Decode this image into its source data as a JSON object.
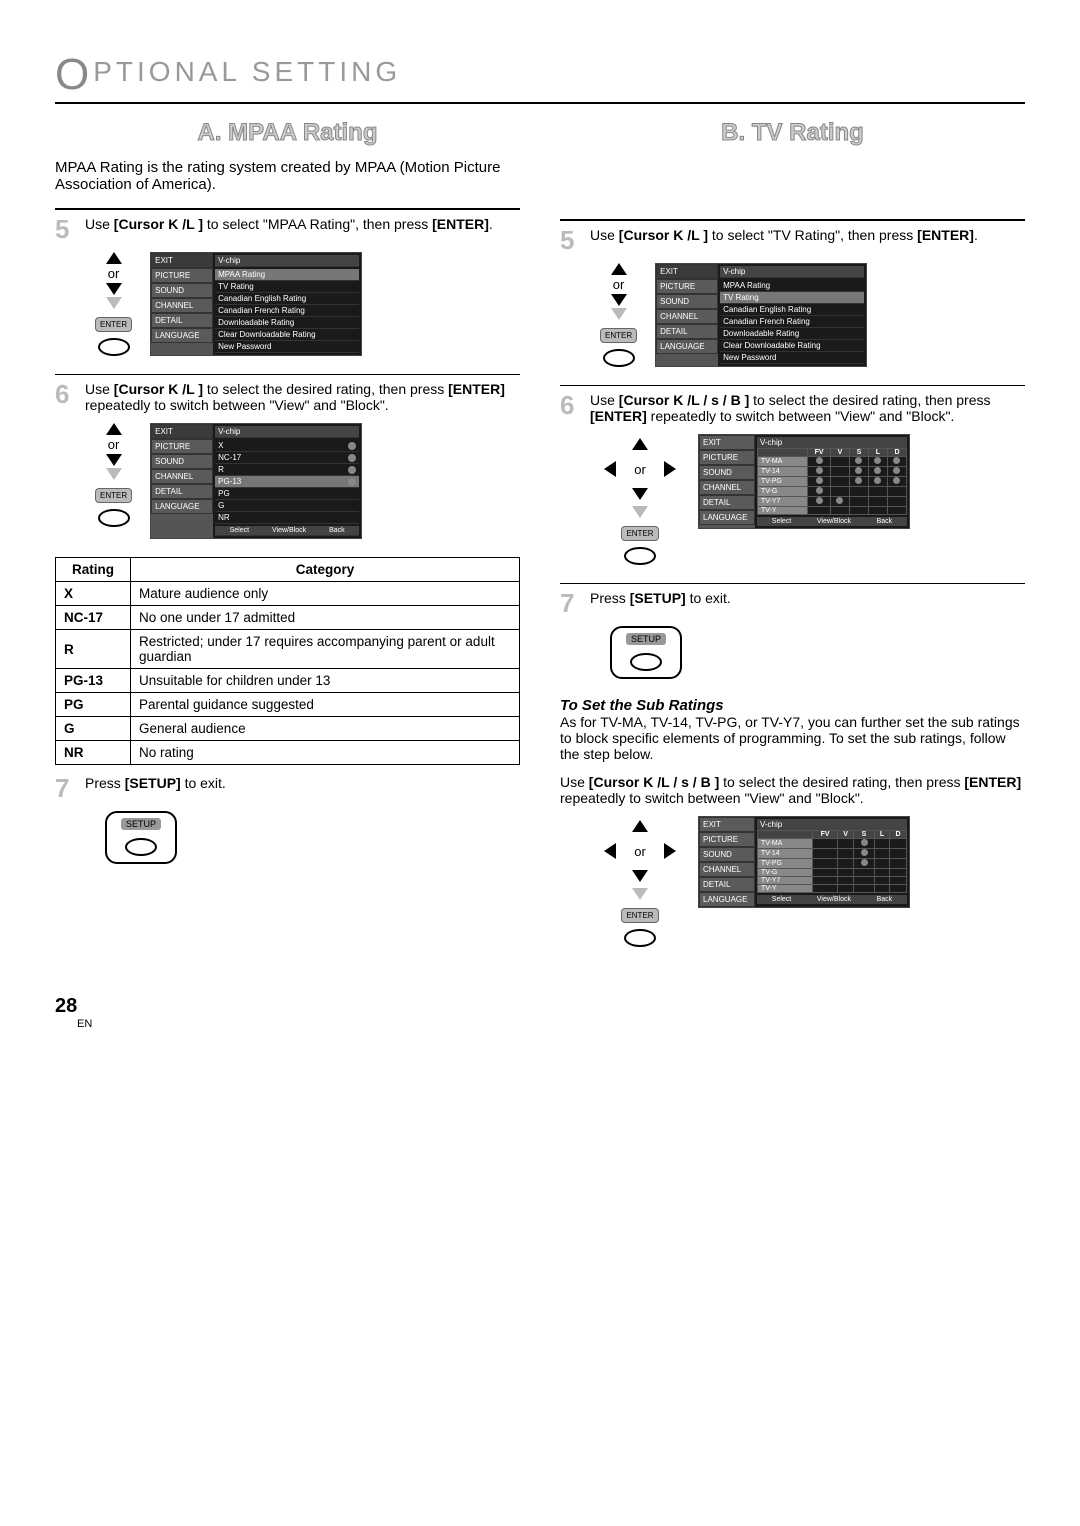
{
  "page": {
    "title_rest": "PTIONAL  SETTING",
    "number": "28",
    "lang": "EN"
  },
  "a": {
    "heading": "A.  MPAA Rating",
    "intro": "MPAA Rating is the rating system created by MPAA (Motion Picture Association of America).",
    "step5": {
      "pre": "Use ",
      "bold1": "[Cursor ",
      "mid": "K /L ]",
      "post": " to select \"MPAA Rating\", then press ",
      "enter": "[ENTER]",
      "tail": "."
    },
    "step6": {
      "text1": "Use ",
      "bold1": "[Cursor ",
      "mid": "K /L ]",
      "text2": " to select the desired rating, then press ",
      "enter": "[ENTER]",
      "text3": " repeatedly to switch between \"View\" and \"Block\"."
    },
    "step7": {
      "pre": "Press ",
      "setup": "[SETUP]",
      "post": " to exit."
    },
    "or": "or",
    "enter_btn": "ENTER",
    "setup_btn": "SETUP"
  },
  "b": {
    "heading": "B.  TV Rating",
    "step5": {
      "pre": "Use ",
      "bold1": "[Cursor ",
      "mid": "K /L ]",
      "post": " to select \"TV Rating\", then press ",
      "enter": "[ENTER]",
      "tail": "."
    },
    "step6": {
      "text1": "Use ",
      "bold1": "[Cursor ",
      "mid": "K /L  / s  / B ]",
      "text2": " to select the desired rating, then press ",
      "enter": "[ENTER]",
      "text3": " repeatedly to switch between \"View\" and \"Block\"."
    },
    "step7": {
      "pre": "Press ",
      "setup": "[SETUP]",
      "post": " to exit."
    },
    "sub_heading": "To Set the Sub Ratings",
    "sub_p1": "As for TV-MA, TV-14, TV-PG, or TV-Y7, you can further set the sub ratings to block specific elements of programming. To set the sub ratings, follow the step below.",
    "sub_p2a": "Use ",
    "sub_bold": "[Cursor ",
    "sub_mid": "K /L  / s  / B ]",
    "sub_p2b": " to select the desired rating, then press ",
    "sub_enter": "[ENTER]",
    "sub_p2c": " repeatedly to switch between \"View\" and \"Block\".",
    "or": "or",
    "enter_btn": "ENTER"
  },
  "osd_tabs": {
    "exit": "EXIT",
    "picture": "PICTURE",
    "sound": "SOUND",
    "channel": "CHANNEL",
    "detail": "DETAIL",
    "language": "LANGUAGE",
    "title": "V-chip",
    "items": [
      "MPAA Rating",
      "TV Rating",
      "Canadian English Rating",
      "Canadian French Rating",
      "Downloadable Rating",
      "Clear Downloadable Rating",
      "New Password"
    ]
  },
  "mpaa_rows": [
    "X",
    "NC-17",
    "R",
    "PG-13",
    "PG",
    "G",
    "NR"
  ],
  "tv_rows": [
    "TV-MA",
    "TV-14",
    "TV-PG",
    "TV-G",
    "TV-Y7",
    "TV-Y"
  ],
  "tv_cols": [
    "FV",
    "V",
    "S",
    "L",
    "D"
  ],
  "footer": {
    "select": "Select",
    "vb": "View/Block",
    "back": "Back"
  },
  "ratings_table": {
    "h1": "Rating",
    "h2": "Category",
    "rows": [
      {
        "r": "X",
        "c": "Mature audience only"
      },
      {
        "r": "NC-17",
        "c": "No one under 17 admitted"
      },
      {
        "r": "R",
        "c": "Restricted; under 17 requires accompanying parent or adult guardian"
      },
      {
        "r": "PG-13",
        "c": "Unsuitable for children under 13"
      },
      {
        "r": "PG",
        "c": "Parental guidance suggested"
      },
      {
        "r": "G",
        "c": "General audience"
      },
      {
        "r": "NR",
        "c": "No rating"
      }
    ]
  }
}
